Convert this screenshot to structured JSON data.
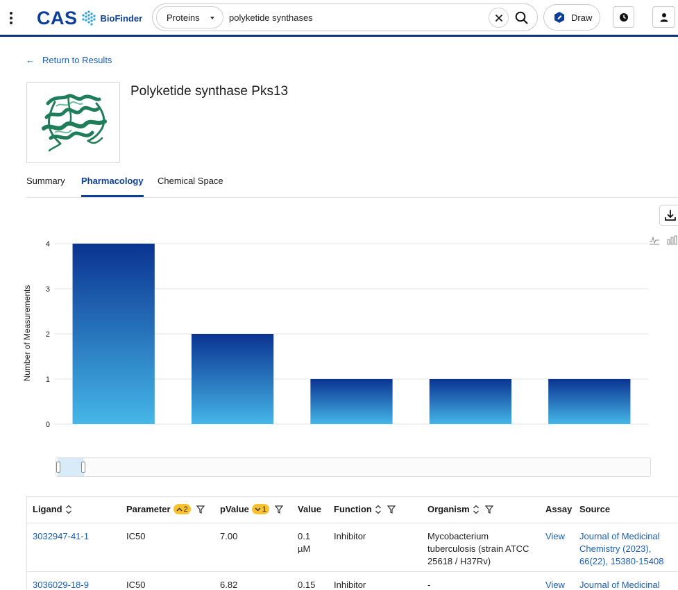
{
  "header": {
    "logo_text": "CAS",
    "logo_sub": "BioFinder",
    "search_scope": "Proteins",
    "search_value": "polyketide synthases",
    "draw_label": "Draw"
  },
  "back_link": "Return to Results",
  "protein": {
    "title": "Polyketide synthase Pks13"
  },
  "tabs": [
    {
      "label": "Summary",
      "active": false
    },
    {
      "label": "Pharmacology",
      "active": true
    },
    {
      "label": "Chemical Space",
      "active": false
    }
  ],
  "chart_data": {
    "type": "bar",
    "ylabel": "Number of Measurements",
    "yticks": [
      0,
      1,
      2,
      3,
      4
    ],
    "ylim": [
      0,
      4
    ],
    "values": [
      4,
      2,
      1,
      1,
      1
    ],
    "colors": {
      "top": "#0a3391",
      "bottom": "#45b6e7"
    },
    "grid": true
  },
  "table": {
    "headers": {
      "ligand": "Ligand",
      "parameter": "Parameter",
      "parameter_badge": "2",
      "pvalue": "pValue",
      "pvalue_badge": "1",
      "value": "Value",
      "function": "Function",
      "organism": "Organism",
      "assay": "Assay",
      "source": "Source"
    },
    "rows": [
      {
        "ligand": "3032947-41-1",
        "parameter": "IC50",
        "pvalue": "7.00",
        "value": [
          "0.1",
          "µM"
        ],
        "function": "Inhibitor",
        "organism": [
          "Mycobacterium",
          "tuberculosis (strain ATCC",
          "25618 / H37Rv)"
        ],
        "assay": "View",
        "source": [
          "Journal of Medicinal",
          "Chemistry (2023),",
          "66(22), 15380-15408"
        ]
      },
      {
        "ligand": "3036029-18-9",
        "parameter": "IC50",
        "pvalue": "6.82",
        "value": [
          "0.15"
        ],
        "function": "Inhibitor",
        "organism": [
          "-"
        ],
        "assay": "View",
        "source": [
          "Journal of Medicinal"
        ]
      }
    ]
  }
}
